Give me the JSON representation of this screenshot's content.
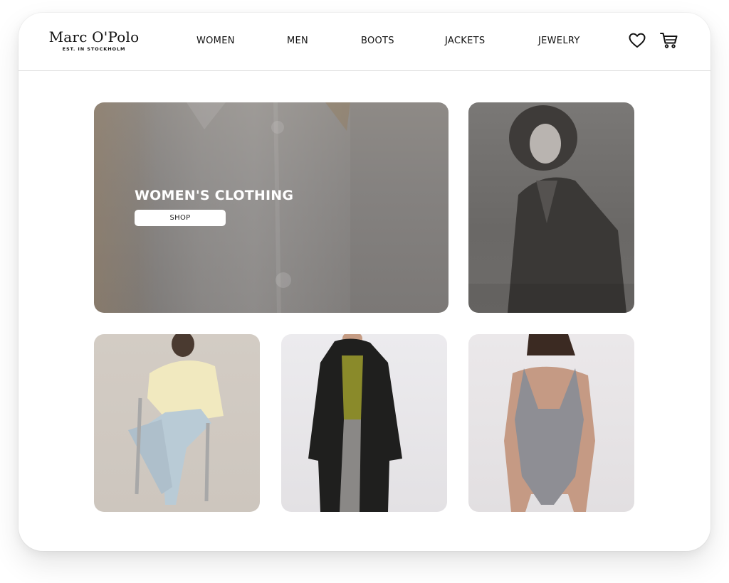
{
  "brand": {
    "name": "Marc O'Polo",
    "tagline": "EST. IN STOCKHOLM"
  },
  "nav": {
    "items": [
      {
        "label": "WOMEN"
      },
      {
        "label": "MEN"
      },
      {
        "label": "BOOTS"
      },
      {
        "label": "JACKETS"
      },
      {
        "label": "JEWELRY"
      }
    ]
  },
  "header_icons": {
    "wishlist": "heart-icon",
    "cart": "cart-icon"
  },
  "hero": {
    "title": "WOMEN'S CLOTHING",
    "button_label": "SHOP"
  },
  "colors": {
    "text": "#111111",
    "divider": "#dcdcdc",
    "hero_overlay": "#858280",
    "button_bg": "#ffffff"
  }
}
